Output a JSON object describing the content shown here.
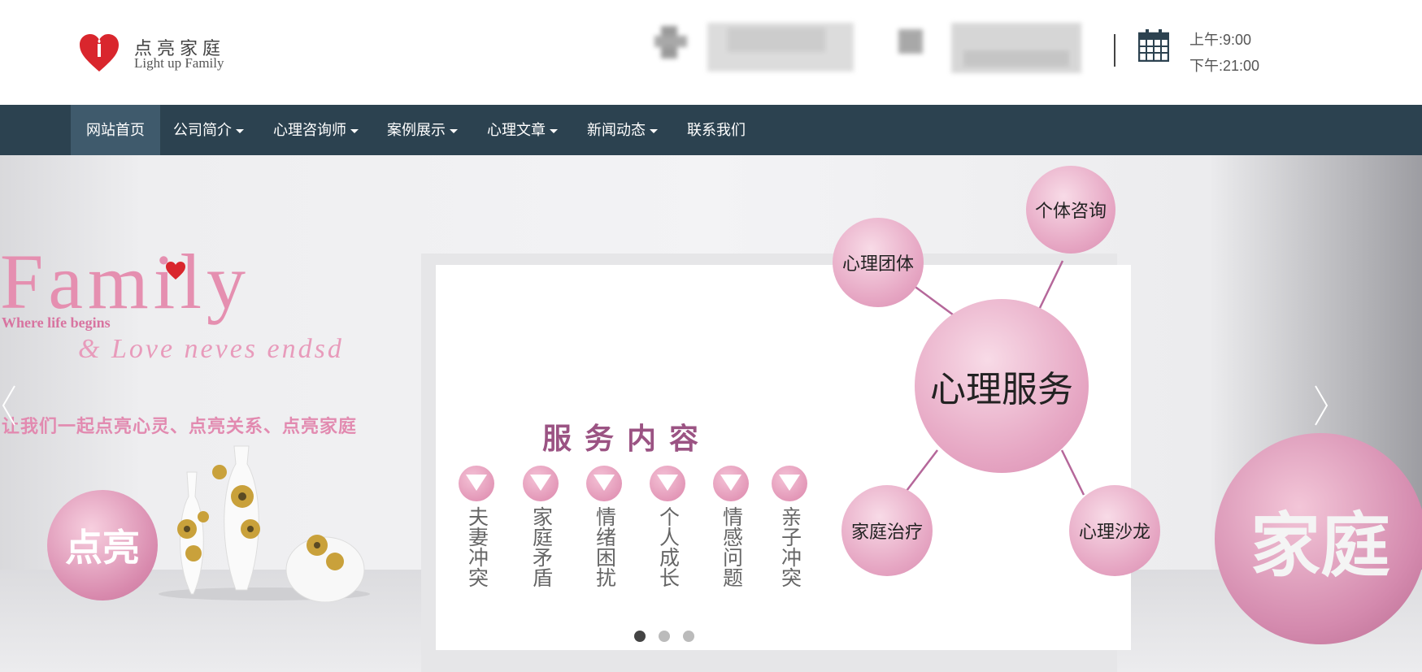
{
  "brand": {
    "name_cn": "点亮家庭",
    "name_en": "Light up Family"
  },
  "hours": {
    "open": "上午:9:00",
    "close": "下午:21:00"
  },
  "nav": {
    "items": [
      {
        "label": "网站首页",
        "dropdown": false,
        "active": true
      },
      {
        "label": "公司简介",
        "dropdown": true,
        "active": false
      },
      {
        "label": "心理咨询师",
        "dropdown": true,
        "active": false
      },
      {
        "label": "案例展示",
        "dropdown": true,
        "active": false
      },
      {
        "label": "心理文章",
        "dropdown": true,
        "active": false
      },
      {
        "label": "新闻动态",
        "dropdown": true,
        "active": false
      },
      {
        "label": "联系我们",
        "dropdown": false,
        "active": false
      }
    ]
  },
  "banner": {
    "family_word": "Family",
    "where_line": "Where life begins",
    "love_line": "& Love neves endsd",
    "slogan": "让我们一起点亮心灵、点亮关系、点亮家庭",
    "left_ball_text": "点亮",
    "right_ball_text": "家庭",
    "service_title": "服务内容",
    "services": [
      "夫妻冲突",
      "家庭矛盾",
      "情绪困扰",
      "个人成长",
      "情感问题",
      "亲子冲突"
    ],
    "mindmap": {
      "center": "心理服务",
      "nodes": [
        "个体咨询",
        "心理团体",
        "家庭治疗",
        "心理沙龙"
      ]
    },
    "slide_count": 3,
    "active_slide": 1
  },
  "colors": {
    "nav_bg": "#2c4250",
    "nav_active": "#3f5a6c",
    "accent_pink": "#e28ab0",
    "title_purple": "#9b5383"
  }
}
